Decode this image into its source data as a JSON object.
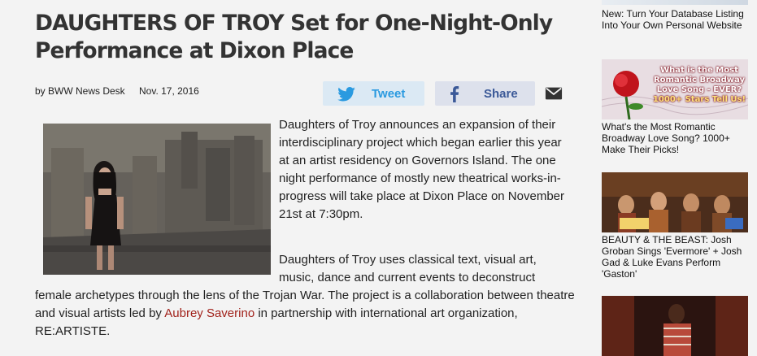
{
  "article": {
    "headline": "DAUGHTERS OF TROY Set for One-Night-Only Performance at Dixon Place",
    "byline": "by BWW News Desk",
    "date": "Nov. 17, 2016",
    "tweet_label": "Tweet",
    "share_label": "Share",
    "para1": "Daughters of Troy announces an expansion of their interdisciplinary project which began earlier this year at an artist residency on Governors Island. The one night performance of mostly new theatrical works-in-progress will take place at Dixon Place on November 21st at 7:30pm.",
    "para2_a": "Daughters of Troy uses classical text, visual art, music, dance and current events to deconstruct",
    "para2_b": "female archetypes through the lens of the Trojan War. The project is a collaboration between theatre and visual artists led by",
    "para2_link": "Aubrey Saverino",
    "para2_c": "in partnership with international art organization, RE:ARTISTE."
  },
  "sidebar": {
    "items": [
      {
        "caption": "New: Turn Your Database Listing Into Your Own Personal Website"
      },
      {
        "caption": "What's the Most Romantic Broadway Love Song? 1000+ Make Their Picks!",
        "thumb_text_1": "What is the Most",
        "thumb_text_2": "Romantic Broadway",
        "thumb_text_3": "Love Song - EVER?",
        "thumb_text_4": "1000+ Stars Tell Us!"
      },
      {
        "caption": "BEAUTY & THE BEAST: Josh Groban Sings 'Evermore' + Josh Gad & Luke Evans Perform 'Gaston'"
      },
      {
        "caption": ""
      }
    ]
  },
  "colors": {
    "link": "#a1221b",
    "tweet_bg": "#dbe9f4",
    "tweet_fg": "#2a9ae0",
    "share_bg": "#dde1ec",
    "share_fg": "#3b5998"
  }
}
